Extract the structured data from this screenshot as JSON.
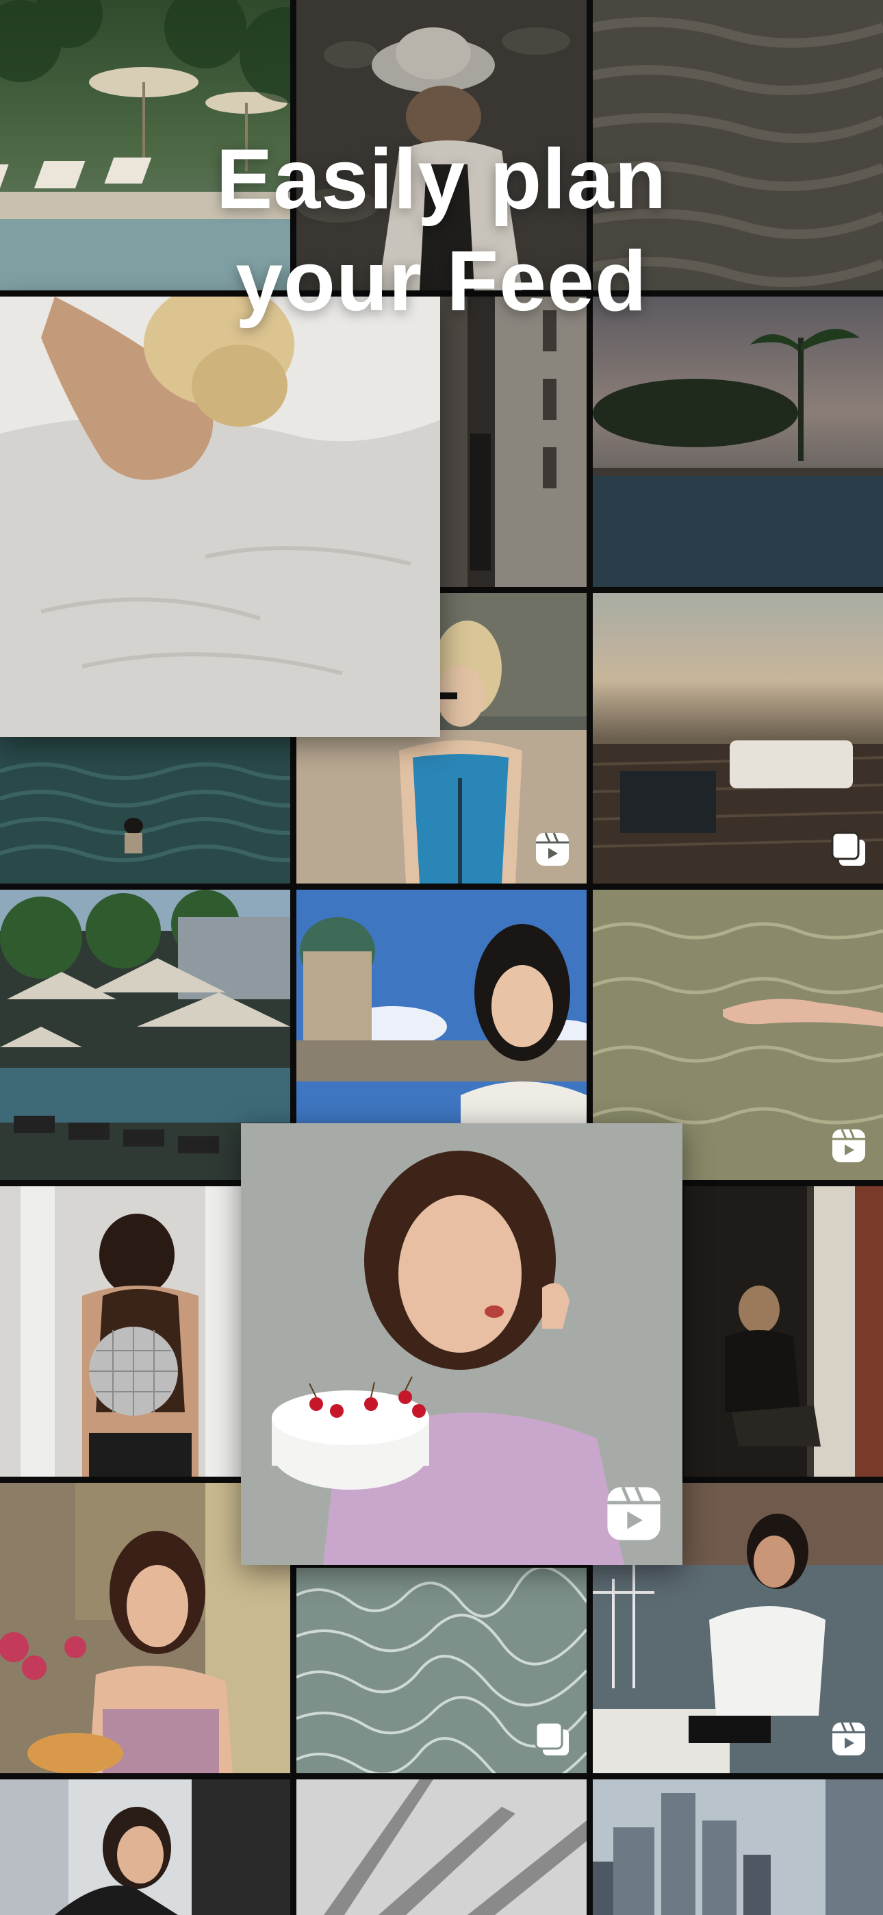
{
  "headline": {
    "line1": "Easily plan",
    "line2": "your Feed"
  },
  "colors": {
    "background": "#0b0b0b",
    "headline": "#ffffff",
    "badge": "#ffffff"
  },
  "tiles": [
    {
      "name": "tile-pool-loungers",
      "subject": "pool with loungers and umbrellas",
      "badge": ""
    },
    {
      "name": "tile-woman-in-hat",
      "subject": "woman in bucket hat on sand",
      "badge": ""
    },
    {
      "name": "tile-sand-ripples",
      "subject": "sand ripples",
      "badge": ""
    },
    {
      "name": "tile-woman-in-bed",
      "subject": "woman lying in white sheets",
      "badge": ""
    },
    {
      "name": "tile-doorway-shadow",
      "subject": "doorway with shadow",
      "badge": ""
    },
    {
      "name": "tile-infinity-pool",
      "subject": "infinity pool at dusk",
      "badge": ""
    },
    {
      "name": "tile-swimmer",
      "subject": "swimmer in turquoise water",
      "badge": ""
    },
    {
      "name": "tile-blue-swimsuit",
      "subject": "woman in blue swimsuit",
      "badge": "reel"
    },
    {
      "name": "tile-desert-deck",
      "subject": "desert deck with daybed",
      "badge": "carousel"
    },
    {
      "name": "tile-umbrellas-pool",
      "subject": "pool umbrellas",
      "badge": ""
    },
    {
      "name": "tile-cathedral-portrait",
      "subject": "woman in front of cathedral dome",
      "badge": ""
    },
    {
      "name": "tile-clear-water",
      "subject": "person in clear shallow water",
      "badge": "reel"
    },
    {
      "name": "tile-disco-ball",
      "subject": "woman holding disco ball",
      "badge": ""
    },
    {
      "name": "tile-birthday-cake",
      "subject": "woman with birthday cake",
      "badge": "reel"
    },
    {
      "name": "tile-door-sitting",
      "subject": "woman sitting in doorway",
      "badge": ""
    },
    {
      "name": "tile-pizza",
      "subject": "woman eating pizza",
      "badge": ""
    },
    {
      "name": "tile-water-caustics",
      "subject": "water caustics",
      "badge": "carousel"
    },
    {
      "name": "tile-boat-woman",
      "subject": "woman on boat",
      "badge": "reel"
    },
    {
      "name": "tile-cover-face",
      "subject": "woman covering face",
      "badge": ""
    },
    {
      "name": "tile-leaf-shadow",
      "subject": "palm leaf shadow",
      "badge": ""
    },
    {
      "name": "tile-skyscrapers",
      "subject": "city skyscrapers",
      "badge": ""
    }
  ]
}
